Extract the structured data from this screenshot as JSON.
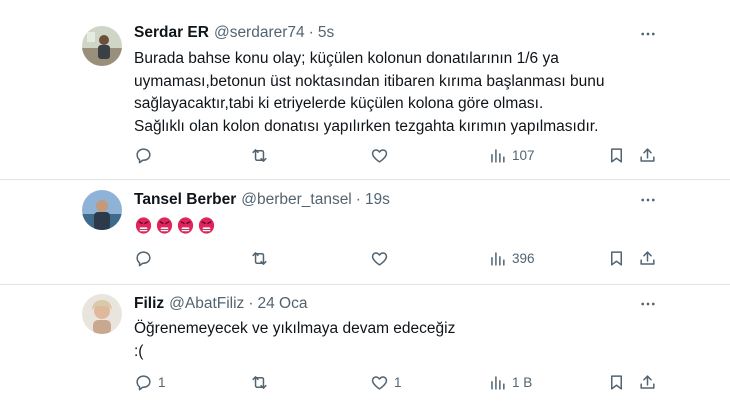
{
  "tweets": [
    {
      "name": "Serdar ER",
      "handle": "@serdarer74",
      "time": "5s",
      "text": "Burada bahse konu olay; küçülen kolonun donatılarının 1/6 ya\nuymaması,betonun üst noktasından itibaren kırıma başlanması bunu\nsağlayacaktır,tabi ki etriyelerde küçülen kolona göre olması.\nSağlıklı olan kolon donatısı yapılırken tezgahta kırımın yapılmasıdır.",
      "replies": "",
      "retweets": "",
      "likes": "",
      "views": "107"
    },
    {
      "name": "Tansel Berber",
      "handle": "@berber_tansel",
      "time": "19s",
      "text": "",
      "emoji": [
        "angry-face-emoji",
        "angry-face-emoji",
        "angry-face-emoji",
        "angry-face-emoji"
      ],
      "replies": "",
      "retweets": "",
      "likes": "",
      "views": "396"
    },
    {
      "name": "Filiz",
      "handle": "@AbatFiliz",
      "time": "24 Oca",
      "text": "Öğrenemeyecek ve yıkılmaya devam edeceğiz\n:(",
      "replies": "1",
      "retweets": "",
      "likes": "1",
      "views": "1 B"
    }
  ],
  "icons": {
    "reply": "reply-icon",
    "retweet": "retweet-icon",
    "like": "heart-icon",
    "views": "views-icon",
    "bookmark": "bookmark-icon",
    "share": "share-icon",
    "more": "more-icon"
  },
  "colors": {
    "text": "#0f1419",
    "secondary": "#536471",
    "divider": "#dfe3e6",
    "emoji_red": "#e0245e"
  }
}
